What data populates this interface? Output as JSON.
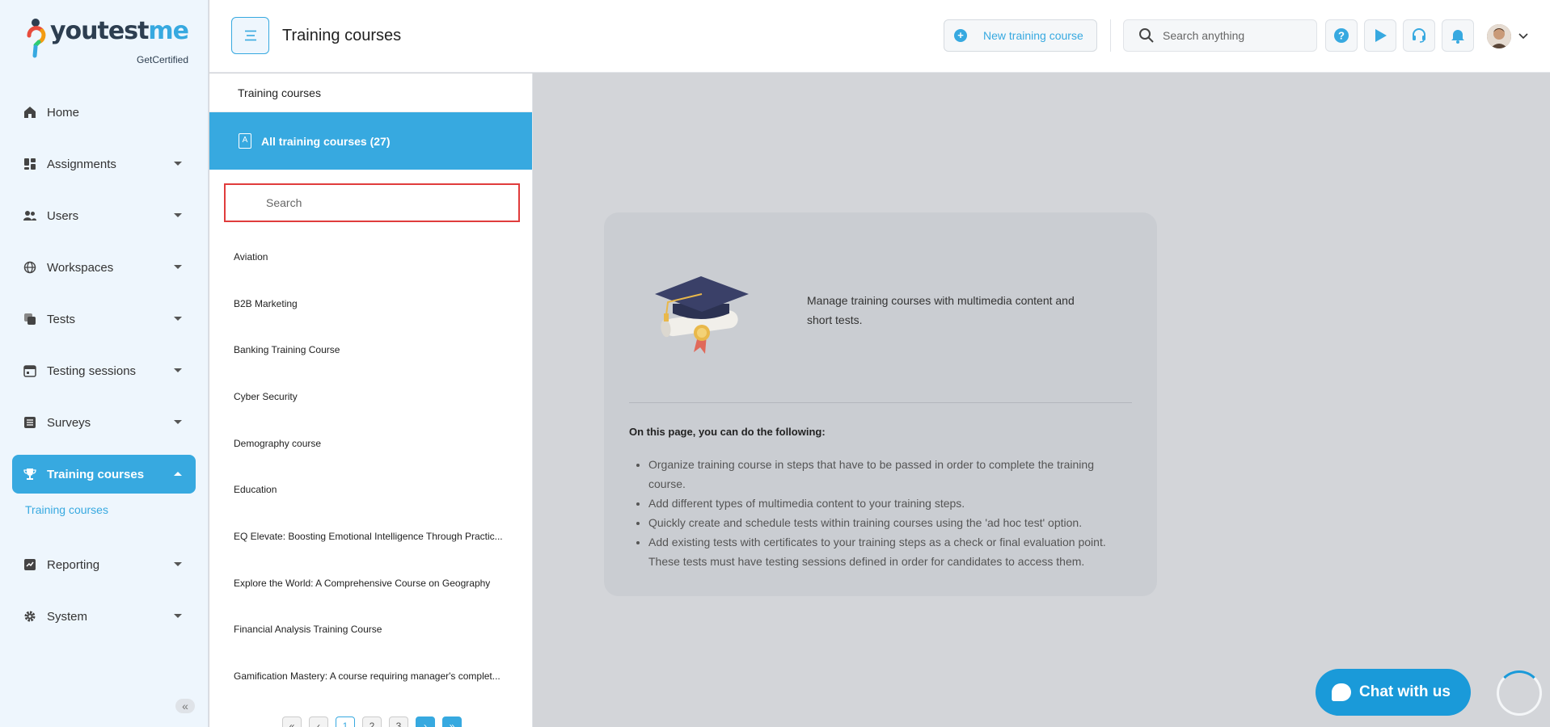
{
  "brand": {
    "name_part1": "youtest",
    "name_part2": "me",
    "tagline": "GetCertified"
  },
  "sidebar": {
    "items": [
      {
        "label": "Home",
        "icon": "home-icon",
        "has_caret": false
      },
      {
        "label": "Assignments",
        "icon": "dashboard-icon",
        "has_caret": true
      },
      {
        "label": "Users",
        "icon": "users-icon",
        "has_caret": true
      },
      {
        "label": "Workspaces",
        "icon": "globe-icon",
        "has_caret": true
      },
      {
        "label": "Tests",
        "icon": "copy-icon",
        "has_caret": true
      },
      {
        "label": "Testing sessions",
        "icon": "calendar-icon",
        "has_caret": true
      },
      {
        "label": "Surveys",
        "icon": "list-icon",
        "has_caret": true
      },
      {
        "label": "Training courses",
        "icon": "trophy-icon",
        "has_caret": true,
        "active": true
      },
      {
        "label": "Reporting",
        "icon": "chart-icon",
        "has_caret": true
      },
      {
        "label": "System",
        "icon": "gear-icon",
        "has_caret": true
      }
    ],
    "sub_item": "Training courses",
    "collapse_label": "«"
  },
  "header": {
    "title": "Training courses",
    "new_button": "New training course",
    "search_placeholder": "Search anything"
  },
  "panel": {
    "title": "Training courses",
    "all_courses": "All training courses (27)",
    "search_placeholder": "Search",
    "courses": [
      "Aviation",
      "B2B Marketing",
      "Banking Training Course",
      "Cyber Security",
      "Demography course",
      "Education",
      "EQ Elevate: Boosting Emotional Intelligence Through Practic...",
      "Explore the World: A Comprehensive Course on Geography",
      "Financial Analysis Training Course",
      "Gamification Mastery: A course requiring manager's complet..."
    ],
    "pager": [
      "«",
      "‹",
      "1",
      "2",
      "3",
      "›",
      "»"
    ]
  },
  "card": {
    "lead": "Manage training courses with multimedia content and short tests.",
    "heading": "On this page, you can do the following:",
    "bullets": [
      "Organize training course in steps that have to be passed in order to complete the training course.",
      "Add different types of multimedia content to your training steps.",
      "Quickly create and schedule tests within training courses using the 'ad hoc test' option.",
      "Add existing tests with certificates to your training steps as a check or final evaluation point. These tests must have testing sessions defined in order for candidates to access them."
    ]
  },
  "chat": {
    "label": "Chat with us"
  },
  "colors": {
    "accent": "#37a9e0",
    "chat": "#1a9ad9",
    "highlight_border": "#e03c3c"
  }
}
